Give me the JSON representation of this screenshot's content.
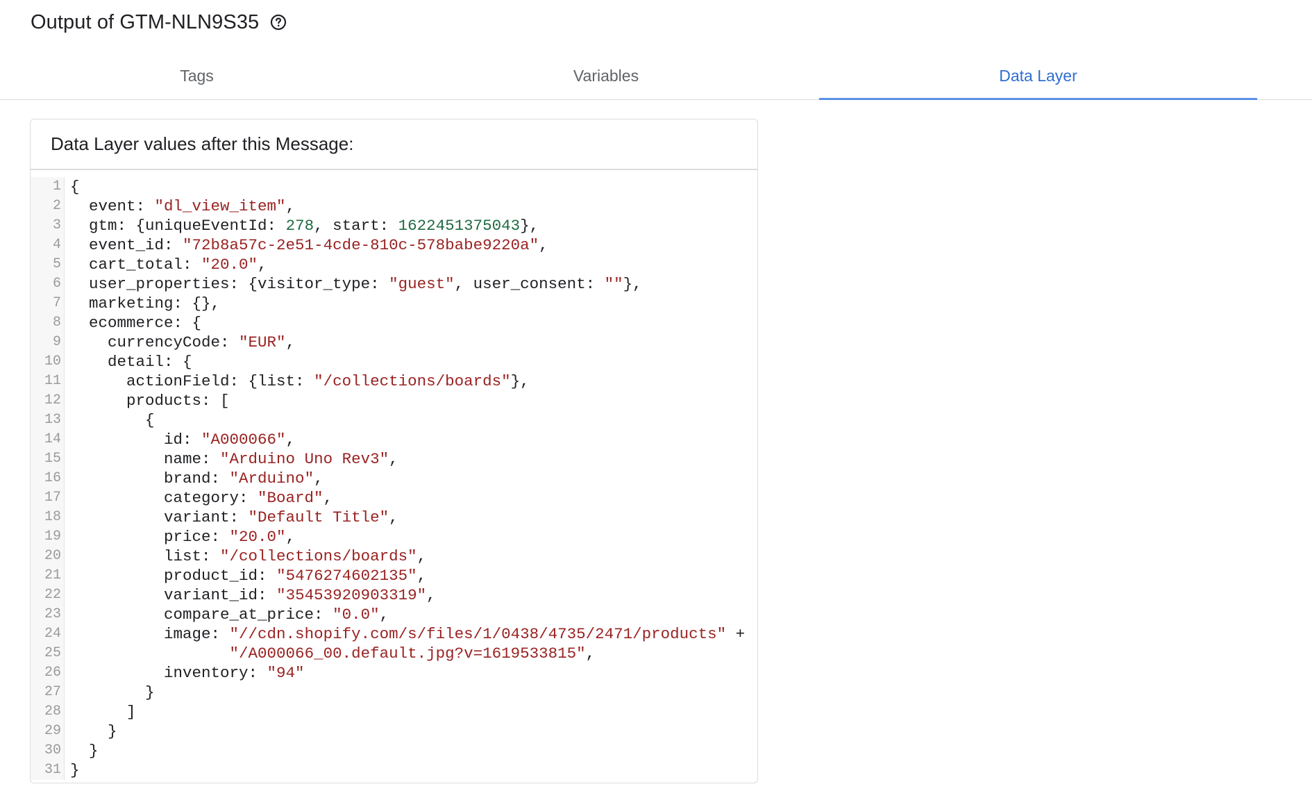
{
  "header": {
    "title": "Output of GTM-NLN9S35"
  },
  "tabs": [
    {
      "label": "Tags",
      "active": false
    },
    {
      "label": "Variables",
      "active": false
    },
    {
      "label": "Data Layer",
      "active": true
    }
  ],
  "card": {
    "title": "Data Layer values after this Message:"
  },
  "colors": {
    "accent": "#2f6fd0",
    "string": "#9a2222",
    "number": "#1f6a43"
  },
  "code_lines": [
    [
      {
        "t": "{"
      }
    ],
    [
      {
        "t": "  event: "
      },
      {
        "t": "\"dl_view_item\"",
        "c": "s"
      },
      {
        "t": ","
      }
    ],
    [
      {
        "t": "  gtm: {uniqueEventId: "
      },
      {
        "t": "278",
        "c": "n"
      },
      {
        "t": ", start: "
      },
      {
        "t": "1622451375043",
        "c": "n"
      },
      {
        "t": "},"
      }
    ],
    [
      {
        "t": "  event_id: "
      },
      {
        "t": "\"72b8a57c-2e51-4cde-810c-578babe9220a\"",
        "c": "s"
      },
      {
        "t": ","
      }
    ],
    [
      {
        "t": "  cart_total: "
      },
      {
        "t": "\"20.0\"",
        "c": "s"
      },
      {
        "t": ","
      }
    ],
    [
      {
        "t": "  user_properties: {visitor_type: "
      },
      {
        "t": "\"guest\"",
        "c": "s"
      },
      {
        "t": ", user_consent: "
      },
      {
        "t": "\"\"",
        "c": "s"
      },
      {
        "t": "},"
      }
    ],
    [
      {
        "t": "  marketing: {},"
      }
    ],
    [
      {
        "t": "  ecommerce: {"
      }
    ],
    [
      {
        "t": "    currencyCode: "
      },
      {
        "t": "\"EUR\"",
        "c": "s"
      },
      {
        "t": ","
      }
    ],
    [
      {
        "t": "    detail: {"
      }
    ],
    [
      {
        "t": "      actionField: {list: "
      },
      {
        "t": "\"/collections/boards\"",
        "c": "s"
      },
      {
        "t": "},"
      }
    ],
    [
      {
        "t": "      products: ["
      }
    ],
    [
      {
        "t": "        {"
      }
    ],
    [
      {
        "t": "          id: "
      },
      {
        "t": "\"A000066\"",
        "c": "s"
      },
      {
        "t": ","
      }
    ],
    [
      {
        "t": "          name: "
      },
      {
        "t": "\"Arduino Uno Rev3\"",
        "c": "s"
      },
      {
        "t": ","
      }
    ],
    [
      {
        "t": "          brand: "
      },
      {
        "t": "\"Arduino\"",
        "c": "s"
      },
      {
        "t": ","
      }
    ],
    [
      {
        "t": "          category: "
      },
      {
        "t": "\"Board\"",
        "c": "s"
      },
      {
        "t": ","
      }
    ],
    [
      {
        "t": "          variant: "
      },
      {
        "t": "\"Default Title\"",
        "c": "s"
      },
      {
        "t": ","
      }
    ],
    [
      {
        "t": "          price: "
      },
      {
        "t": "\"20.0\"",
        "c": "s"
      },
      {
        "t": ","
      }
    ],
    [
      {
        "t": "          list: "
      },
      {
        "t": "\"/collections/boards\"",
        "c": "s"
      },
      {
        "t": ","
      }
    ],
    [
      {
        "t": "          product_id: "
      },
      {
        "t": "\"5476274602135\"",
        "c": "s"
      },
      {
        "t": ","
      }
    ],
    [
      {
        "t": "          variant_id: "
      },
      {
        "t": "\"35453920903319\"",
        "c": "s"
      },
      {
        "t": ","
      }
    ],
    [
      {
        "t": "          compare_at_price: "
      },
      {
        "t": "\"0.0\"",
        "c": "s"
      },
      {
        "t": ","
      }
    ],
    [
      {
        "t": "          image: "
      },
      {
        "t": "\"//cdn.shopify.com/s/files/1/0438/4735/2471/products\"",
        "c": "s"
      },
      {
        "t": " +"
      }
    ],
    [
      {
        "t": "                 "
      },
      {
        "t": "\"/A000066_00.default.jpg?v=1619533815\"",
        "c": "s"
      },
      {
        "t": ","
      }
    ],
    [
      {
        "t": "          inventory: "
      },
      {
        "t": "\"94\"",
        "c": "s"
      }
    ],
    [
      {
        "t": "        }"
      }
    ],
    [
      {
        "t": "      ]"
      }
    ],
    [
      {
        "t": "    }"
      }
    ],
    [
      {
        "t": "  }"
      }
    ],
    [
      {
        "t": "}"
      }
    ]
  ]
}
